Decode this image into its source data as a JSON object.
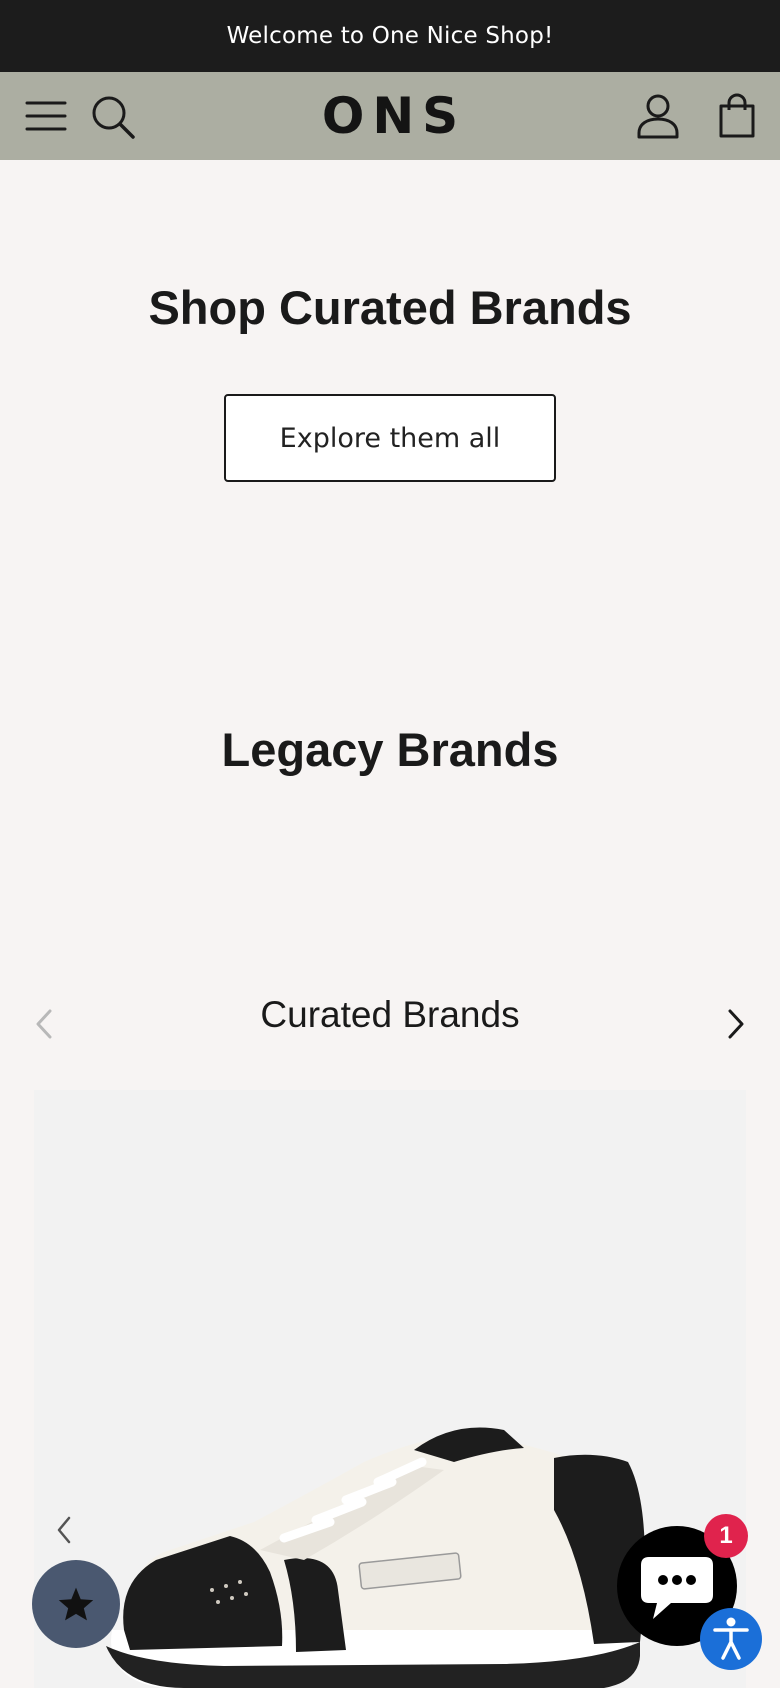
{
  "announcement": {
    "text": "Welcome to One Nice Shop!"
  },
  "header": {
    "logo": "ONS",
    "icons": [
      "menu-icon",
      "search-icon",
      "account-icon",
      "cart-icon"
    ]
  },
  "hero": {
    "title": "Shop Curated Brands",
    "button_label": "Explore them all"
  },
  "legacy": {
    "title": "Legacy Brands"
  },
  "carousel": {
    "title": "Curated Brands",
    "product_image": "sneaker"
  },
  "chat": {
    "badge_count": "1"
  },
  "colors": {
    "announcement_bg": "#1c1c1c",
    "header_bg": "#acaea2",
    "page_bg": "#f7f4f3",
    "rewards_bg": "#4a5870",
    "badge": "#e0234d",
    "accessibility": "#1b6fd8"
  }
}
